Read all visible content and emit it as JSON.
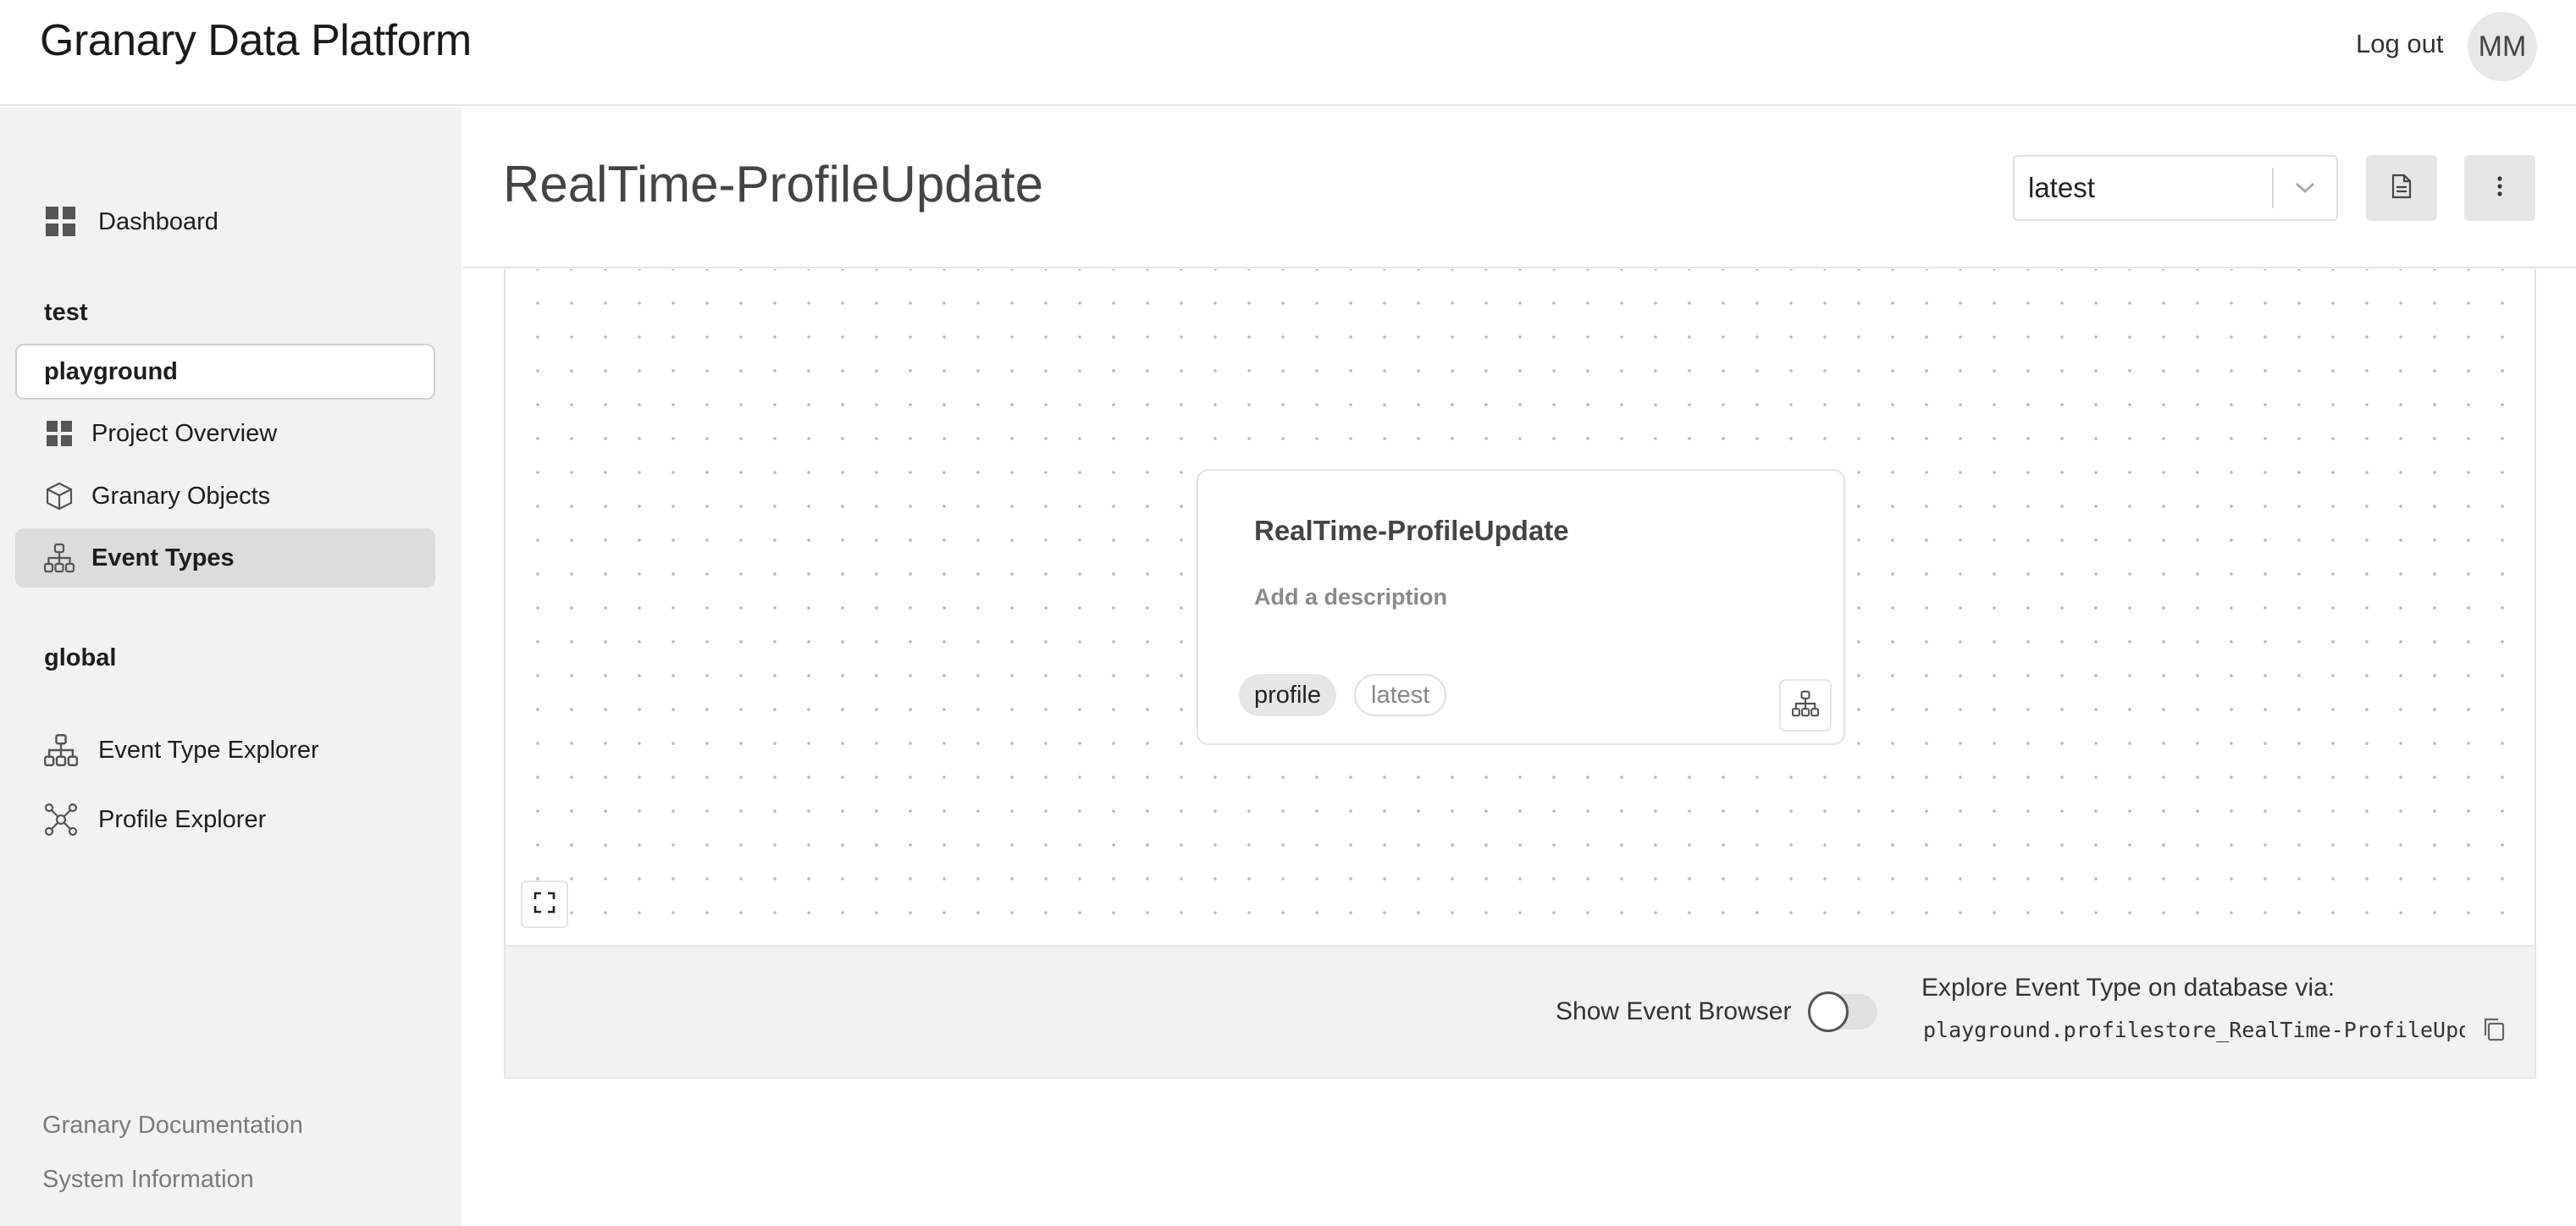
{
  "header": {
    "app_title": "Granary Data Platform",
    "logout_label": "Log out",
    "avatar_initials": "MM"
  },
  "sidebar": {
    "dashboard_label": "Dashboard",
    "section_test": "test",
    "project_name": "playground",
    "project_items": [
      {
        "label": "Project Overview",
        "icon": "grid-icon"
      },
      {
        "label": "Granary Objects",
        "icon": "cube-icon"
      },
      {
        "label": "Event Types",
        "icon": "hierarchy-icon",
        "active": true
      }
    ],
    "section_global": "global",
    "global_items": [
      {
        "label": "Event Type Explorer",
        "icon": "hierarchy-icon"
      },
      {
        "label": "Profile Explorer",
        "icon": "network-icon"
      }
    ],
    "footer_links": [
      "Granary Documentation",
      "System Information"
    ]
  },
  "page": {
    "title": "RealTime-ProfileUpdate",
    "version_selected": "latest",
    "document_button_icon": "document-icon",
    "more_button_icon": "more-vertical-icon"
  },
  "node": {
    "title": "RealTime-ProfileUpdate",
    "description_placeholder": "Add a description",
    "tags": [
      "profile",
      "latest"
    ]
  },
  "bottom": {
    "show_event_browser_label": "Show Event Browser",
    "show_event_browser_on": false,
    "explore_label": "Explore Event Type on database via:",
    "table_reference": "playground.profilestore_RealTime-ProfileUpdate"
  },
  "colors": {
    "sidebar_bg": "#f2f2f2",
    "active_item_bg": "#dcdcdc",
    "canvas_dot": "#b8b8b8"
  }
}
